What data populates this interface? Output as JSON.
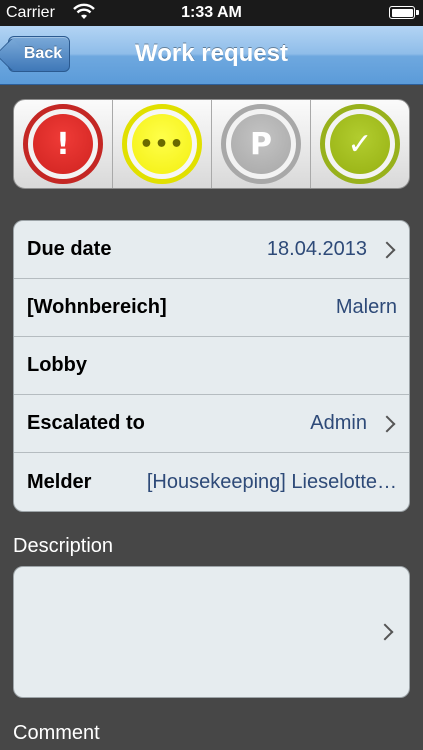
{
  "status_bar": {
    "carrier": "Carrier",
    "time": "1:33 AM",
    "icons": [
      "wifi-icon",
      "battery-icon"
    ]
  },
  "nav": {
    "back_label": "Back",
    "title": "Work request"
  },
  "status_buttons": [
    {
      "name": "urgent",
      "symbol": "!",
      "color": "#d42a26"
    },
    {
      "name": "in-progress",
      "symbol": "•••",
      "color": "#f0ee10"
    },
    {
      "name": "parked",
      "symbol": "P",
      "color": "#a8a8a8"
    },
    {
      "name": "done",
      "symbol": "✓",
      "color": "#a0ba1a"
    }
  ],
  "form": {
    "rows": [
      {
        "label": "Due date",
        "value": "18.04.2013",
        "has_chevron": true
      },
      {
        "label": "[Wohnbereich]",
        "value": "Malern",
        "has_chevron": false
      },
      {
        "label": "Lobby",
        "value": "",
        "has_chevron": false
      },
      {
        "label": "Escalated to",
        "value": "Admin",
        "has_chevron": true
      },
      {
        "label": "Melder",
        "value": "[Housekeeping] Lieselotte…",
        "has_chevron": false
      }
    ]
  },
  "description": {
    "label": "Description",
    "value": ""
  },
  "comment": {
    "label": "Comment"
  },
  "colors": {
    "background": "#474747",
    "nav_blue": "#6ea8df",
    "value_text": "#2e4a78"
  }
}
